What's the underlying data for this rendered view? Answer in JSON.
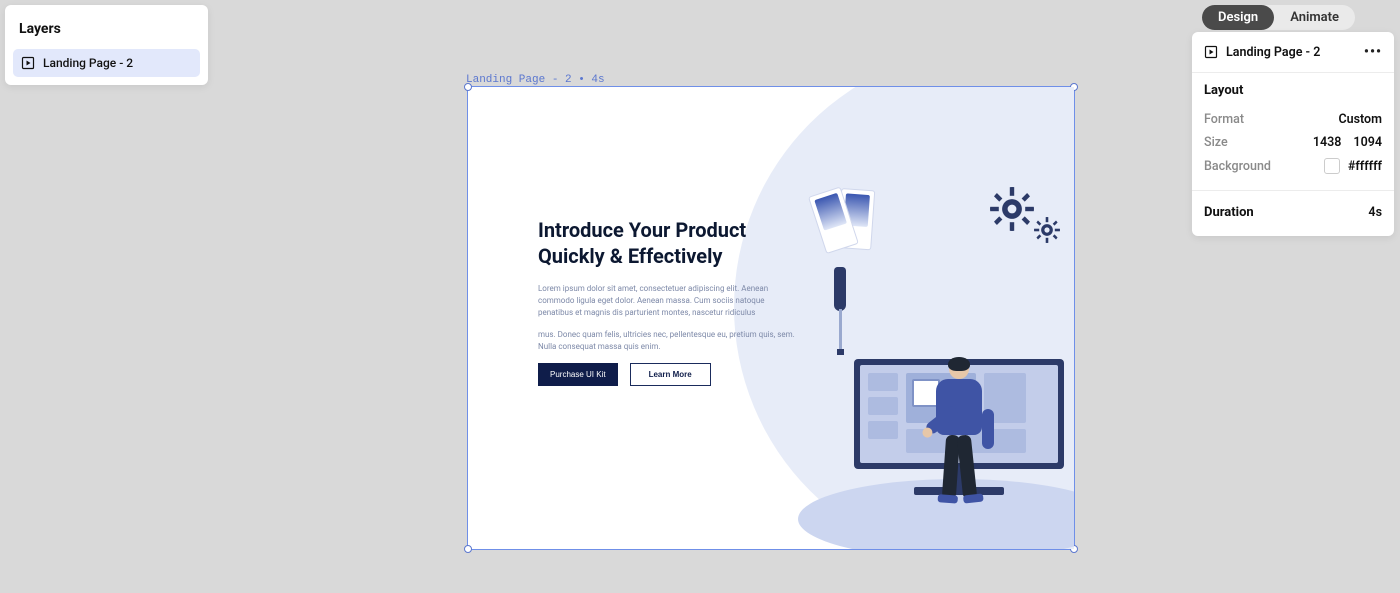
{
  "layers": {
    "title": "Layers",
    "items": [
      {
        "label": "Landing Page - 2"
      }
    ]
  },
  "modes": {
    "design": "Design",
    "animate": "Animate"
  },
  "props": {
    "title": "Landing Page - 2",
    "layout_heading": "Layout",
    "format_label": "Format",
    "format_value": "Custom",
    "size_label": "Size",
    "size_w": "1438",
    "size_h": "1094",
    "background_label": "Background",
    "background_value": "#ffffff",
    "duration_label": "Duration",
    "duration_value": "4s"
  },
  "canvas": {
    "label": "Landing Page - 2 • 4s",
    "hero_title": "Introduce Your Product Quickly & Effectively",
    "hero_p1": "Lorem ipsum dolor sit amet, consectetuer adipiscing elit. Aenean commodo ligula eget dolor. Aenean massa. Cum sociis natoque penatibus et magnis dis parturient montes, nascetur ridiculus",
    "hero_p2": "mus. Donec quam felis, ultricies nec, pellentesque eu, pretium quis, sem. Nulla consequat massa quis enim.",
    "btn_primary": "Purchase UI Kit",
    "btn_secondary": "Learn More"
  }
}
